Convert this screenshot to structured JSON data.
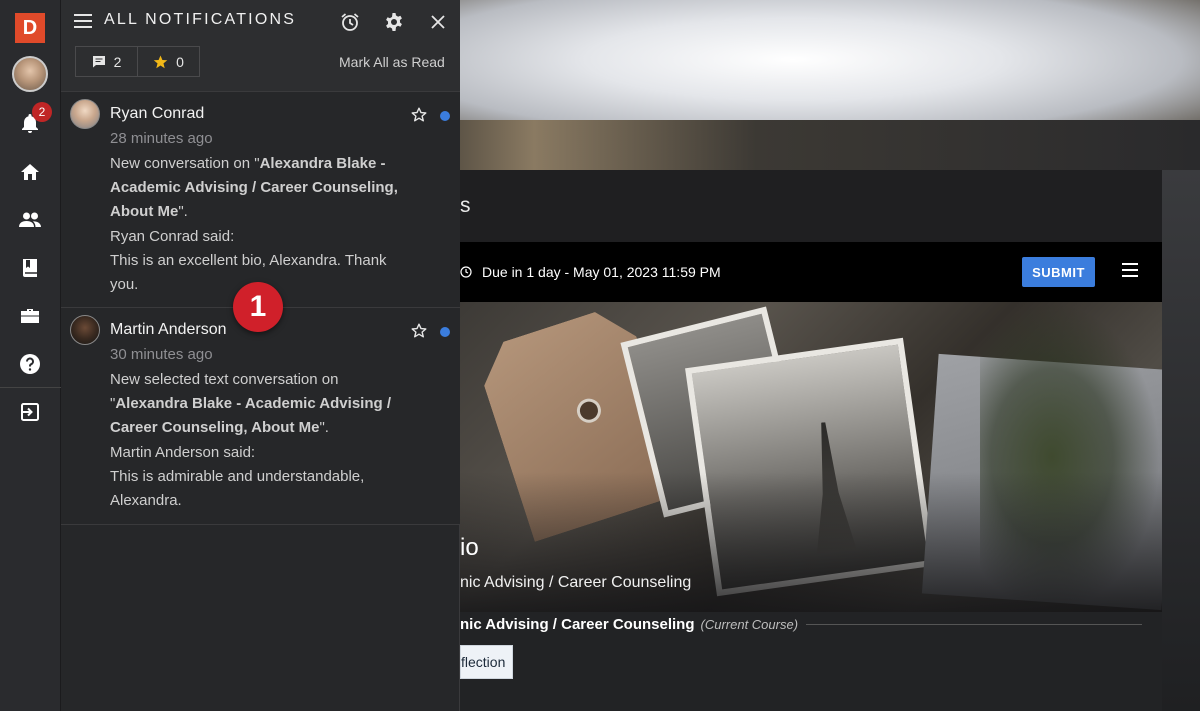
{
  "rail": {
    "logo_letter": "D",
    "notification_count": "2",
    "icons": [
      "bell-icon",
      "home-icon",
      "people-icon",
      "book-icon",
      "briefcase-icon",
      "help-icon",
      "exit-icon"
    ]
  },
  "panel": {
    "title": "ALL NOTIFICATIONS",
    "comment_count": "2",
    "star_count": "0",
    "mark_all_label": "Mark All as Read"
  },
  "notifications": [
    {
      "name": "Ryan Conrad",
      "time": "28 minutes ago",
      "prefix": "New conversation on \"",
      "highlight": "Alexandra Blake - Academic Advising / Career Counseling, About Me",
      "suffix": "\".",
      "said": "Ryan Conrad said:",
      "message": "This is an excellent bio, Alexandra. Thank you."
    },
    {
      "name": "Martin Anderson",
      "time": "30 minutes ago",
      "prefix": "New selected text conversation on \"",
      "highlight": "Alexandra Blake - Academic Advising / Career Counseling, About Me",
      "suffix": "\".",
      "said": "Martin Anderson said:",
      "message": "This is admirable and understandable, Alexandra."
    }
  ],
  "step_badge": "1",
  "background": {
    "card_title_fragment": "s",
    "due_text": "Due in 1 day - May 01, 2023 11:59 PM",
    "submit_label": "SUBMIT",
    "hero_heading_fragment": "io",
    "hero_sub_fragment": "nic Advising / Career Counseling",
    "course_fragment": "nic Advising / Career Counseling",
    "course_note": "(Current Course)",
    "button_fragment": "flection"
  },
  "colors": {
    "accent_blue": "#3b7ddd",
    "badge_red": "#c02626",
    "logo_orange": "#e04a2a"
  }
}
